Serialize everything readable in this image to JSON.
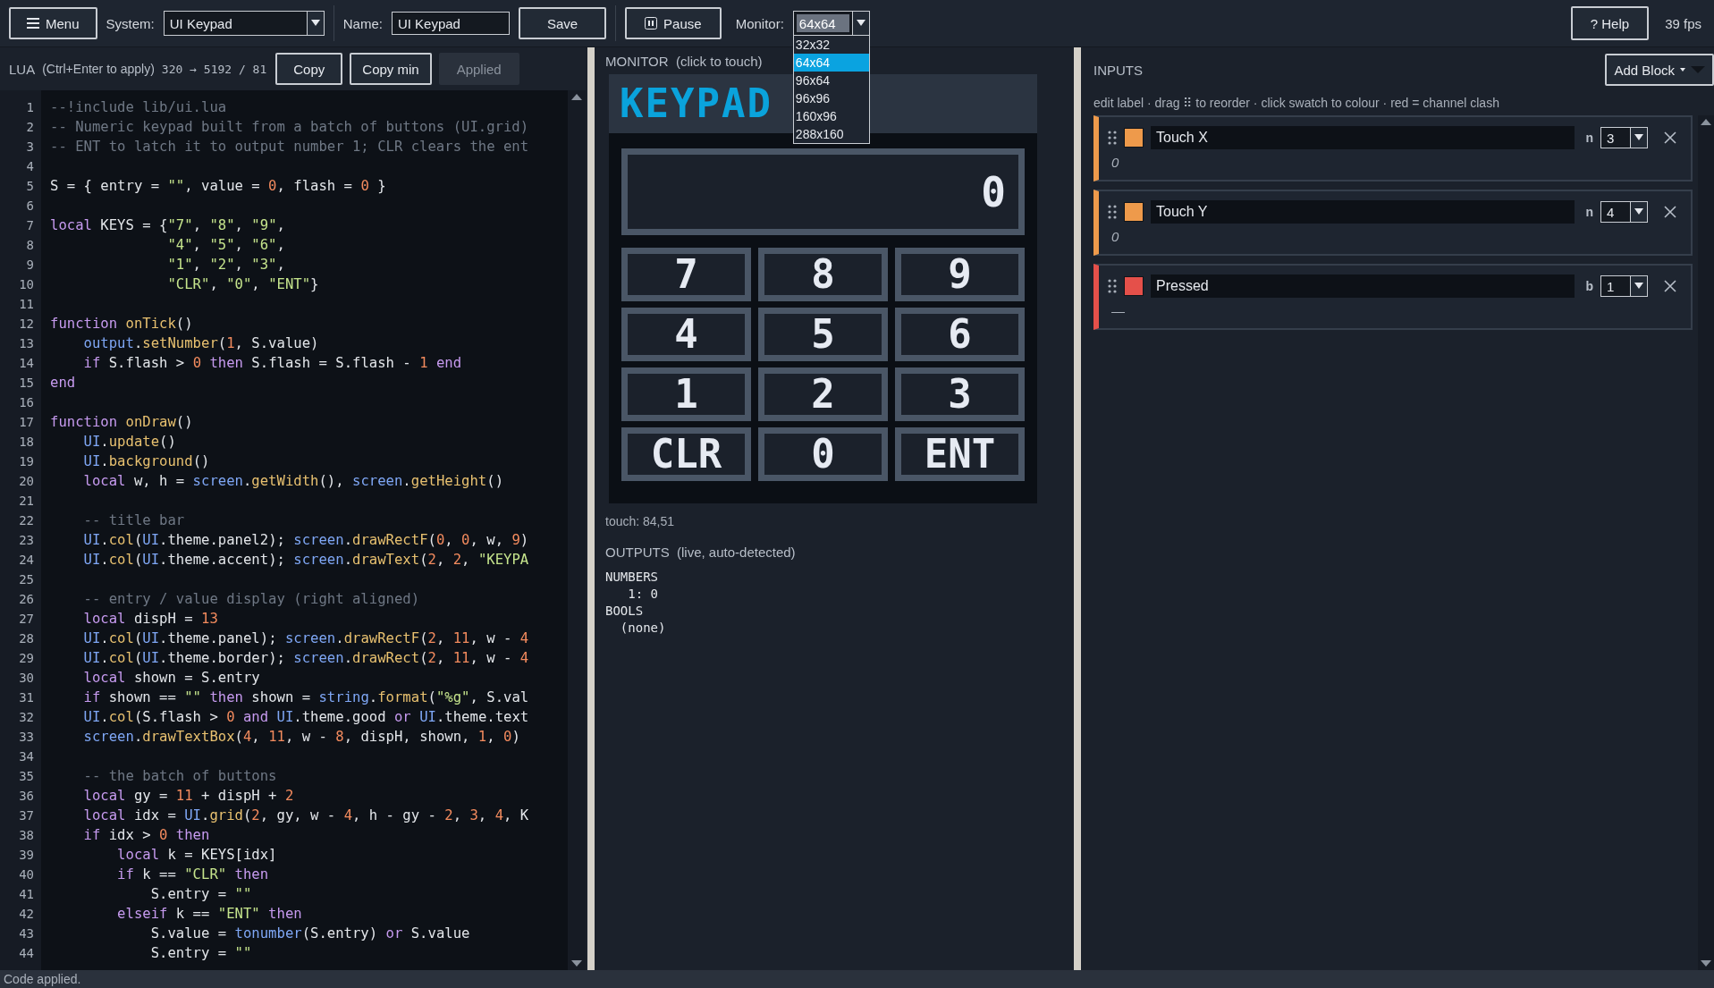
{
  "toolbar": {
    "menu": "Menu",
    "system_label": "System:",
    "system": "UI Keypad",
    "name_label": "Name:",
    "name": "UI Keypad",
    "save": "Save",
    "pause": "Pause",
    "monitor_label": "Monitor:",
    "monitor_size": "64x64",
    "monitor_options": [
      {
        "label": "32x32",
        "selected": false
      },
      {
        "label": "64x64",
        "selected": true
      },
      {
        "label": "96x64",
        "selected": false
      },
      {
        "label": "96x96",
        "selected": false
      },
      {
        "label": "160x96",
        "selected": false
      },
      {
        "label": "288x160",
        "selected": false
      }
    ],
    "help": "? Help",
    "fps": "39 fps"
  },
  "editor": {
    "title": "LUA",
    "hint": "(Ctrl+Enter to apply)",
    "stats": "320 → 5192 / 81",
    "buttons": [
      {
        "label": "Copy",
        "disabled": false
      },
      {
        "label": "Copy min",
        "disabled": false
      },
      {
        "label": "Applied",
        "disabled": true
      }
    ],
    "lines": [
      {
        "number": "1",
        "segments": [
          {
            "kind": "comment",
            "text": "--!include lib/ui.lua"
          }
        ]
      },
      {
        "number": "2",
        "segments": [
          {
            "kind": "comment",
            "text": "-- Numeric keypad built from a batch of buttons (UI.grid)"
          }
        ]
      },
      {
        "number": "3",
        "segments": [
          {
            "kind": "comment",
            "text": "-- ENT to latch it to output number 1; CLR clears the ent"
          }
        ]
      },
      {
        "number": "4"
      },
      {
        "number": "5",
        "segments": [
          {
            "kind": "plain",
            "text": "S = { entry = "
          },
          {
            "kind": "string",
            "text": "\"\""
          },
          {
            "kind": "plain",
            "text": ", value = "
          },
          {
            "kind": "number",
            "text": "0"
          },
          {
            "kind": "plain",
            "text": ", flash = "
          },
          {
            "kind": "number",
            "text": "0"
          },
          {
            "kind": "plain",
            "text": " }"
          }
        ]
      },
      {
        "number": "6"
      },
      {
        "number": "7",
        "segments": [
          {
            "kind": "keyword",
            "text": "local"
          },
          {
            "kind": "plain",
            "text": " KEYS = {"
          },
          {
            "kind": "string",
            "text": "\"7\""
          },
          {
            "kind": "plain",
            "text": ", "
          },
          {
            "kind": "string",
            "text": "\"8\""
          },
          {
            "kind": "plain",
            "text": ", "
          },
          {
            "kind": "string",
            "text": "\"9\""
          },
          {
            "kind": "plain",
            "text": ","
          }
        ]
      },
      {
        "number": "8",
        "segments": [
          {
            "kind": "string",
            "text": "              \"4\""
          },
          {
            "kind": "plain",
            "text": ", "
          },
          {
            "kind": "string",
            "text": "\"5\""
          },
          {
            "kind": "plain",
            "text": ", "
          },
          {
            "kind": "string",
            "text": "\"6\""
          },
          {
            "kind": "plain",
            "text": ","
          }
        ]
      },
      {
        "number": "9",
        "segments": [
          {
            "kind": "string",
            "text": "              \"1\""
          },
          {
            "kind": "plain",
            "text": ", "
          },
          {
            "kind": "string",
            "text": "\"2\""
          },
          {
            "kind": "plain",
            "text": ", "
          },
          {
            "kind": "string",
            "text": "\"3\""
          },
          {
            "kind": "plain",
            "text": ","
          }
        ]
      },
      {
        "number": "10",
        "segments": [
          {
            "kind": "string",
            "text": "              \"CLR\""
          },
          {
            "kind": "plain",
            "text": ", "
          },
          {
            "kind": "string",
            "text": "\"0\""
          },
          {
            "kind": "plain",
            "text": ", "
          },
          {
            "kind": "string",
            "text": "\"ENT\""
          },
          {
            "kind": "plain",
            "text": "}"
          }
        ]
      },
      {
        "number": "11"
      },
      {
        "number": "12",
        "segments": [
          {
            "kind": "keyword",
            "text": "function"
          },
          {
            "kind": "call",
            "text": " onTick"
          },
          {
            "kind": "plain",
            "text": "()"
          }
        ]
      },
      {
        "number": "13",
        "segments": [
          {
            "kind": "lib",
            "text": "    output"
          },
          {
            "kind": "plain",
            "text": "."
          },
          {
            "kind": "call",
            "text": "setNumber"
          },
          {
            "kind": "plain",
            "text": "("
          },
          {
            "kind": "number",
            "text": "1"
          },
          {
            "kind": "plain",
            "text": ", S.value)"
          }
        ]
      },
      {
        "number": "14",
        "segments": [
          {
            "kind": "keyword",
            "text": "    if"
          },
          {
            "kind": "plain",
            "text": " S.flash > "
          },
          {
            "kind": "number",
            "text": "0"
          },
          {
            "kind": "keyword",
            "text": " then"
          },
          {
            "kind": "plain",
            "text": " S.flash = S.flash - "
          },
          {
            "kind": "number",
            "text": "1"
          },
          {
            "kind": "keyword",
            "text": " end"
          }
        ]
      },
      {
        "number": "15",
        "segments": [
          {
            "kind": "keyword",
            "text": "end"
          }
        ]
      },
      {
        "number": "16"
      },
      {
        "number": "17",
        "segments": [
          {
            "kind": "keyword",
            "text": "function"
          },
          {
            "kind": "call",
            "text": " onDraw"
          },
          {
            "kind": "plain",
            "text": "()"
          }
        ]
      },
      {
        "number": "18",
        "segments": [
          {
            "kind": "lib",
            "text": "    UI"
          },
          {
            "kind": "plain",
            "text": "."
          },
          {
            "kind": "call",
            "text": "update"
          },
          {
            "kind": "plain",
            "text": "()"
          }
        ]
      },
      {
        "number": "19",
        "segments": [
          {
            "kind": "lib",
            "text": "    UI"
          },
          {
            "kind": "plain",
            "text": "."
          },
          {
            "kind": "call",
            "text": "background"
          },
          {
            "kind": "plain",
            "text": "()"
          }
        ]
      },
      {
        "number": "20",
        "segments": [
          {
            "kind": "keyword",
            "text": "    local"
          },
          {
            "kind": "plain",
            "text": " w, h = "
          },
          {
            "kind": "lib",
            "text": "screen"
          },
          {
            "kind": "plain",
            "text": "."
          },
          {
            "kind": "call",
            "text": "getWidth"
          },
          {
            "kind": "plain",
            "text": "(), "
          },
          {
            "kind": "lib",
            "text": "screen"
          },
          {
            "kind": "plain",
            "text": "."
          },
          {
            "kind": "call",
            "text": "getHeight"
          },
          {
            "kind": "plain",
            "text": "()"
          }
        ]
      },
      {
        "number": "21"
      },
      {
        "number": "22",
        "segments": [
          {
            "kind": "comment",
            "text": "    -- title bar"
          }
        ]
      },
      {
        "number": "23",
        "segments": [
          {
            "kind": "lib",
            "text": "    UI"
          },
          {
            "kind": "plain",
            "text": "."
          },
          {
            "kind": "call",
            "text": "col"
          },
          {
            "kind": "plain",
            "text": "("
          },
          {
            "kind": "lib",
            "text": "UI"
          },
          {
            "kind": "plain",
            "text": ".theme.panel2); "
          },
          {
            "kind": "lib",
            "text": "screen"
          },
          {
            "kind": "plain",
            "text": "."
          },
          {
            "kind": "call",
            "text": "drawRectF"
          },
          {
            "kind": "plain",
            "text": "("
          },
          {
            "kind": "number",
            "text": "0"
          },
          {
            "kind": "plain",
            "text": ", "
          },
          {
            "kind": "number",
            "text": "0"
          },
          {
            "kind": "plain",
            "text": ", w, "
          },
          {
            "kind": "number",
            "text": "9"
          },
          {
            "kind": "plain",
            "text": ")"
          }
        ]
      },
      {
        "number": "24",
        "segments": [
          {
            "kind": "lib",
            "text": "    UI"
          },
          {
            "kind": "plain",
            "text": "."
          },
          {
            "kind": "call",
            "text": "col"
          },
          {
            "kind": "plain",
            "text": "("
          },
          {
            "kind": "lib",
            "text": "UI"
          },
          {
            "kind": "plain",
            "text": ".theme.accent); "
          },
          {
            "kind": "lib",
            "text": "screen"
          },
          {
            "kind": "plain",
            "text": "."
          },
          {
            "kind": "call",
            "text": "drawText"
          },
          {
            "kind": "plain",
            "text": "("
          },
          {
            "kind": "number",
            "text": "2"
          },
          {
            "kind": "plain",
            "text": ", "
          },
          {
            "kind": "number",
            "text": "2"
          },
          {
            "kind": "plain",
            "text": ", "
          },
          {
            "kind": "string",
            "text": "\"KEYPA"
          }
        ]
      },
      {
        "number": "25"
      },
      {
        "number": "26",
        "segments": [
          {
            "kind": "comment",
            "text": "    -- entry / value display (right aligned)"
          }
        ]
      },
      {
        "number": "27",
        "segments": [
          {
            "kind": "keyword",
            "text": "    local"
          },
          {
            "kind": "plain",
            "text": " dispH = "
          },
          {
            "kind": "number",
            "text": "13"
          }
        ]
      },
      {
        "number": "28",
        "segments": [
          {
            "kind": "lib",
            "text": "    UI"
          },
          {
            "kind": "plain",
            "text": "."
          },
          {
            "kind": "call",
            "text": "col"
          },
          {
            "kind": "plain",
            "text": "("
          },
          {
            "kind": "lib",
            "text": "UI"
          },
          {
            "kind": "plain",
            "text": ".theme.panel); "
          },
          {
            "kind": "lib",
            "text": "screen"
          },
          {
            "kind": "plain",
            "text": "."
          },
          {
            "kind": "call",
            "text": "drawRectF"
          },
          {
            "kind": "plain",
            "text": "("
          },
          {
            "kind": "number",
            "text": "2"
          },
          {
            "kind": "plain",
            "text": ", "
          },
          {
            "kind": "number",
            "text": "11"
          },
          {
            "kind": "plain",
            "text": ", w - "
          },
          {
            "kind": "number",
            "text": "4"
          }
        ]
      },
      {
        "number": "29",
        "segments": [
          {
            "kind": "lib",
            "text": "    UI"
          },
          {
            "kind": "plain",
            "text": "."
          },
          {
            "kind": "call",
            "text": "col"
          },
          {
            "kind": "plain",
            "text": "("
          },
          {
            "kind": "lib",
            "text": "UI"
          },
          {
            "kind": "plain",
            "text": ".theme.border); "
          },
          {
            "kind": "lib",
            "text": "screen"
          },
          {
            "kind": "plain",
            "text": "."
          },
          {
            "kind": "call",
            "text": "drawRect"
          },
          {
            "kind": "plain",
            "text": "("
          },
          {
            "kind": "number",
            "text": "2"
          },
          {
            "kind": "plain",
            "text": ", "
          },
          {
            "kind": "number",
            "text": "11"
          },
          {
            "kind": "plain",
            "text": ", w - "
          },
          {
            "kind": "number",
            "text": "4"
          }
        ]
      },
      {
        "number": "30",
        "segments": [
          {
            "kind": "keyword",
            "text": "    local"
          },
          {
            "kind": "plain",
            "text": " shown = S.entry"
          }
        ]
      },
      {
        "number": "31",
        "segments": [
          {
            "kind": "keyword",
            "text": "    if"
          },
          {
            "kind": "plain",
            "text": " shown == "
          },
          {
            "kind": "string",
            "text": "\"\""
          },
          {
            "kind": "keyword",
            "text": " then"
          },
          {
            "kind": "plain",
            "text": " shown = "
          },
          {
            "kind": "lib",
            "text": "string"
          },
          {
            "kind": "plain",
            "text": "."
          },
          {
            "kind": "call",
            "text": "format"
          },
          {
            "kind": "plain",
            "text": "("
          },
          {
            "kind": "string",
            "text": "\"%g\""
          },
          {
            "kind": "plain",
            "text": ", S.val"
          }
        ]
      },
      {
        "number": "32",
        "segments": [
          {
            "kind": "lib",
            "text": "    UI"
          },
          {
            "kind": "plain",
            "text": "."
          },
          {
            "kind": "call",
            "text": "col"
          },
          {
            "kind": "plain",
            "text": "(S.flash > "
          },
          {
            "kind": "number",
            "text": "0"
          },
          {
            "kind": "keyword",
            "text": " and"
          },
          {
            "kind": "lib",
            "text": " UI"
          },
          {
            "kind": "plain",
            "text": ".theme.good "
          },
          {
            "kind": "keyword",
            "text": "or"
          },
          {
            "kind": "lib",
            "text": " UI"
          },
          {
            "kind": "plain",
            "text": ".theme.text"
          }
        ]
      },
      {
        "number": "33",
        "segments": [
          {
            "kind": "lib",
            "text": "    screen"
          },
          {
            "kind": "plain",
            "text": "."
          },
          {
            "kind": "call",
            "text": "drawTextBox"
          },
          {
            "kind": "plain",
            "text": "("
          },
          {
            "kind": "number",
            "text": "4"
          },
          {
            "kind": "plain",
            "text": ", "
          },
          {
            "kind": "number",
            "text": "11"
          },
          {
            "kind": "plain",
            "text": ", w - "
          },
          {
            "kind": "number",
            "text": "8"
          },
          {
            "kind": "plain",
            "text": ", dispH, shown, "
          },
          {
            "kind": "number",
            "text": "1"
          },
          {
            "kind": "plain",
            "text": ", "
          },
          {
            "kind": "number",
            "text": "0"
          },
          {
            "kind": "plain",
            "text": ")"
          }
        ]
      },
      {
        "number": "34"
      },
      {
        "number": "35",
        "segments": [
          {
            "kind": "comment",
            "text": "    -- the batch of buttons"
          }
        ]
      },
      {
        "number": "36",
        "segments": [
          {
            "kind": "keyword",
            "text": "    local"
          },
          {
            "kind": "plain",
            "text": " gy = "
          },
          {
            "kind": "number",
            "text": "11"
          },
          {
            "kind": "plain",
            "text": " + dispH + "
          },
          {
            "kind": "number",
            "text": "2"
          }
        ]
      },
      {
        "number": "37",
        "segments": [
          {
            "kind": "keyword",
            "text": "    local"
          },
          {
            "kind": "plain",
            "text": " idx = "
          },
          {
            "kind": "lib",
            "text": "UI"
          },
          {
            "kind": "plain",
            "text": "."
          },
          {
            "kind": "call",
            "text": "grid"
          },
          {
            "kind": "plain",
            "text": "("
          },
          {
            "kind": "number",
            "text": "2"
          },
          {
            "kind": "plain",
            "text": ", gy, w - "
          },
          {
            "kind": "number",
            "text": "4"
          },
          {
            "kind": "plain",
            "text": ", h - gy - "
          },
          {
            "kind": "number",
            "text": "2"
          },
          {
            "kind": "plain",
            "text": ", "
          },
          {
            "kind": "number",
            "text": "3"
          },
          {
            "kind": "plain",
            "text": ", "
          },
          {
            "kind": "number",
            "text": "4"
          },
          {
            "kind": "plain",
            "text": ", K"
          }
        ]
      },
      {
        "number": "38",
        "segments": [
          {
            "kind": "keyword",
            "text": "    if"
          },
          {
            "kind": "plain",
            "text": " idx > "
          },
          {
            "kind": "number",
            "text": "0"
          },
          {
            "kind": "keyword",
            "text": " then"
          }
        ]
      },
      {
        "number": "39",
        "segments": [
          {
            "kind": "keyword",
            "text": "        local"
          },
          {
            "kind": "plain",
            "text": " k = KEYS[idx]"
          }
        ]
      },
      {
        "number": "40",
        "segments": [
          {
            "kind": "keyword",
            "text": "        if"
          },
          {
            "kind": "plain",
            "text": " k == "
          },
          {
            "kind": "string",
            "text": "\"CLR\""
          },
          {
            "kind": "keyword",
            "text": " then"
          }
        ]
      },
      {
        "number": "41",
        "segments": [
          {
            "kind": "plain",
            "text": "            S.entry = "
          },
          {
            "kind": "string",
            "text": "\"\""
          }
        ]
      },
      {
        "number": "42",
        "segments": [
          {
            "kind": "keyword",
            "text": "        elseif"
          },
          {
            "kind": "plain",
            "text": " k == "
          },
          {
            "kind": "string",
            "text": "\"ENT\""
          },
          {
            "kind": "keyword",
            "text": " then"
          }
        ]
      },
      {
        "number": "43",
        "segments": [
          {
            "kind": "plain",
            "text": "            S.value = "
          },
          {
            "kind": "lib",
            "text": "tonumber"
          },
          {
            "kind": "plain",
            "text": "(S.entry) "
          },
          {
            "kind": "keyword",
            "text": "or"
          },
          {
            "kind": "plain",
            "text": " S.value"
          }
        ]
      },
      {
        "number": "44",
        "segments": [
          {
            "kind": "plain",
            "text": "            S.entry = "
          },
          {
            "kind": "string",
            "text": "\"\""
          }
        ]
      }
    ]
  },
  "monitor": {
    "title": "MONITOR",
    "hint": "(click to touch)",
    "screen": {
      "title": "KEYPAD",
      "display": "0",
      "keys": [
        "7",
        "8",
        "9",
        "4",
        "5",
        "6",
        "1",
        "2",
        "3",
        "CLR",
        "0",
        "ENT"
      ]
    },
    "touch": "touch: 84,51"
  },
  "outputs": {
    "title": "OUTPUTS",
    "hint": "(live, auto-detected)",
    "lines": [
      "NUMBERS",
      "   1: 0",
      "BOOLS",
      "  (none)"
    ]
  },
  "inputs": {
    "title": "INPUTS",
    "add_button": "Add Block",
    "hint": "edit label · drag ⠿ to reorder · click swatch to colour · red = channel clash",
    "blocks": [
      {
        "label": "Touch X",
        "color": "#ee9a4b",
        "type": "n",
        "channel": "3",
        "value": "0"
      },
      {
        "label": "Touch Y",
        "color": "#ee9a4b",
        "type": "n",
        "channel": "4",
        "value": "0"
      },
      {
        "label": "Pressed",
        "color": "#e5504a",
        "type": "b",
        "channel": "1",
        "value": "—"
      }
    ]
  },
  "status_bar": "Code applied."
}
